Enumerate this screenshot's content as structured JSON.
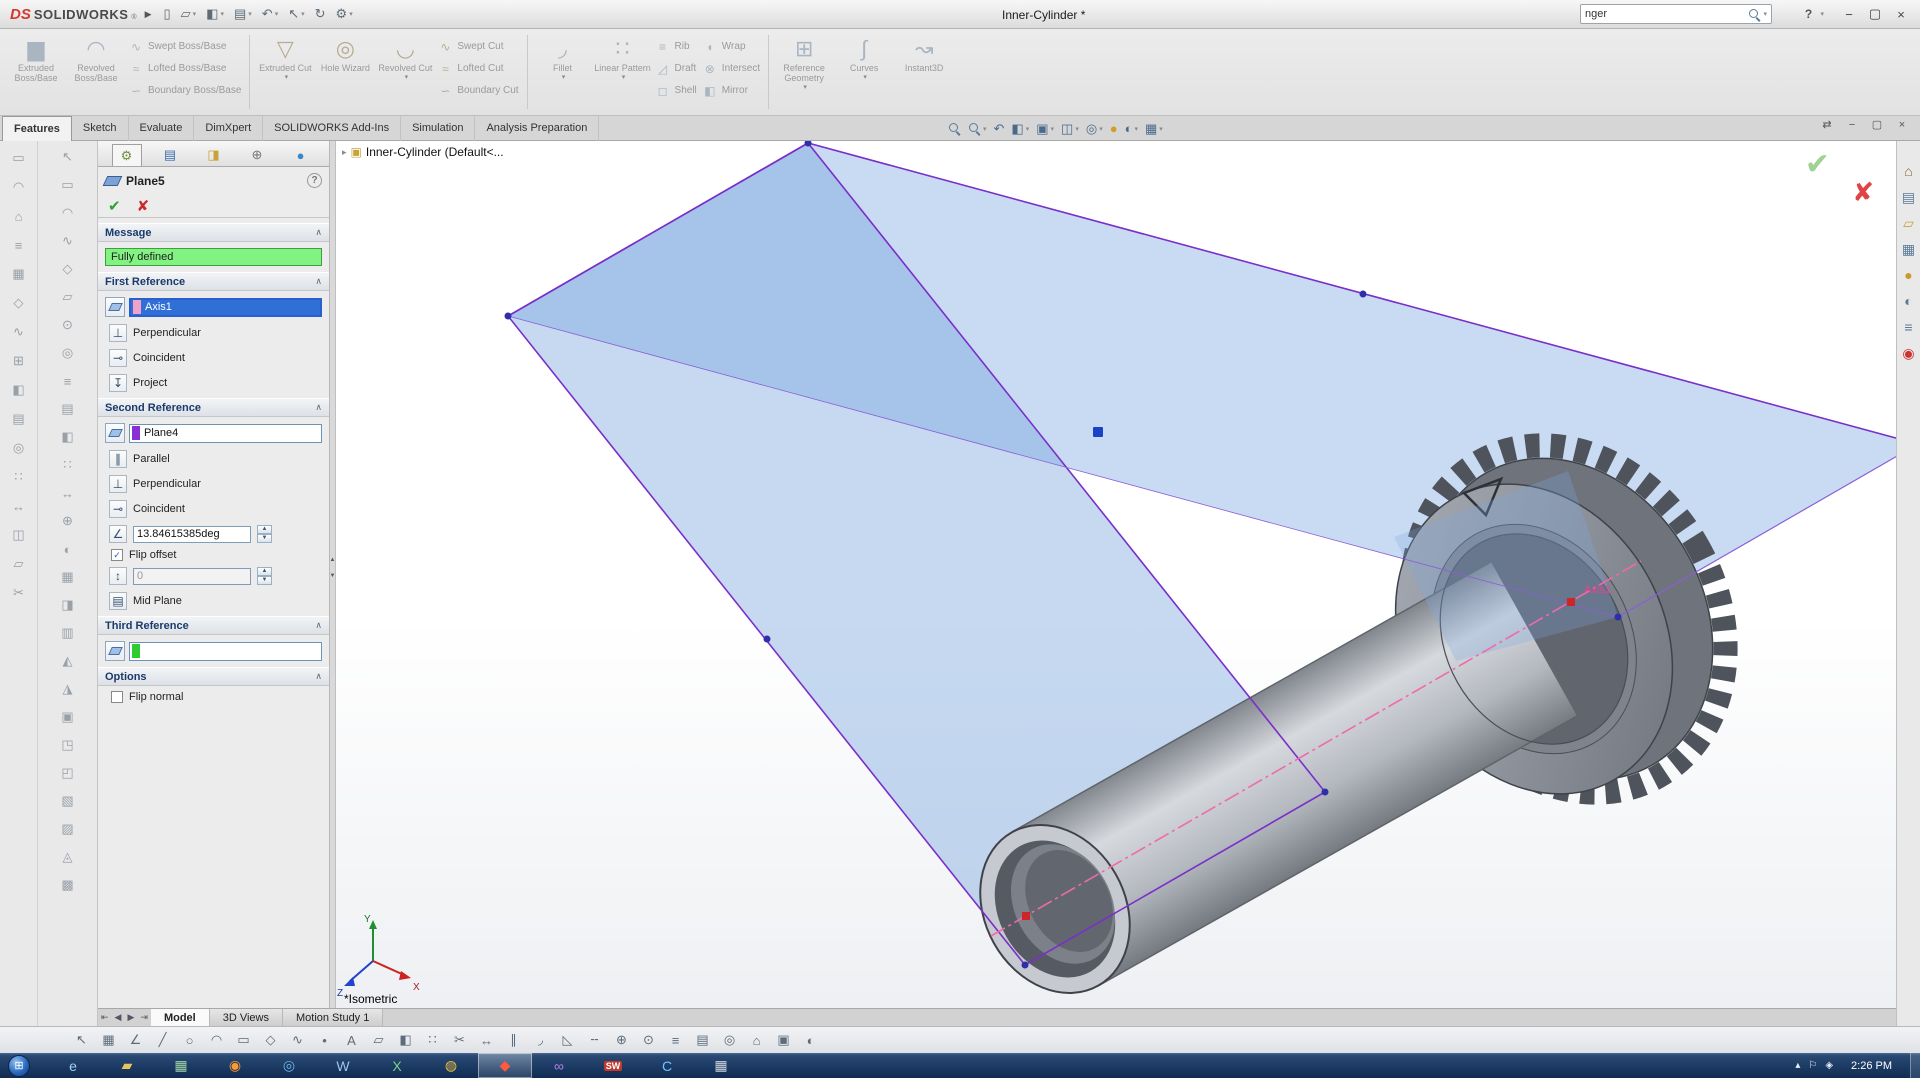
{
  "ui_glyphs": {
    "caret": "▾",
    "chevron_up": "∧",
    "spin_up": "▲",
    "spin_down": "▼",
    "check": "✓",
    "tree_arrow": "▸",
    "orb": "⊞"
  },
  "colors": {
    "accent_blue": "#2f6fd6",
    "plane_fill": "#78a5de",
    "plane_edge": "#7a2fc9",
    "fully_defined_green": "#82f282",
    "axis_pink": "#f06aaa",
    "taskbar_blue": "#1b3a64",
    "selection_pink": "#f2a2c8",
    "reference_purple": "#8a2fd6",
    "reference_green": "#2ecc2e"
  },
  "titlebar": {
    "logo_text": "SOLIDWORKS",
    "logo_mark": "®",
    "logo_ds": "DS",
    "flyout_arrow": "▶",
    "title": "Inner-Cylinder *",
    "search_value": "nger",
    "quick_icons": [
      {
        "name": "new-file-button",
        "glyph": "▯"
      },
      {
        "name": "open-file-button",
        "glyph": "▱",
        "caret": true
      },
      {
        "name": "save-button",
        "glyph": "◧",
        "caret": true
      },
      {
        "name": "print-button",
        "glyph": "▤",
        "caret": true
      },
      {
        "name": "undo-button",
        "glyph": "↶",
        "caret": true
      },
      {
        "name": "select-button",
        "glyph": "↖",
        "caret": true
      },
      {
        "name": "rebuild-button",
        "glyph": "↻"
      },
      {
        "name": "options-button",
        "glyph": "⚙",
        "caret": true
      }
    ]
  },
  "window_controls": {
    "help": "?",
    "pane_toggle": "⇄",
    "minimize": "−",
    "restore": "▢",
    "close": "×"
  },
  "ribbon": {
    "groups": [
      {
        "big": [
          {
            "name": "extruded-boss-base-button",
            "label": "Extruded Boss/Base",
            "glyph": "▆",
            "color": "#a9b6c2"
          },
          {
            "name": "revolved-boss-base-button",
            "label": "Revolved Boss/Base",
            "glyph": "◠",
            "color": "#a9b6c2"
          }
        ],
        "stacks": [
          [
            {
              "name": "swept-boss-base-button",
              "label": "Swept Boss/Base",
              "glyph": "∿",
              "color": "#a9b6c2"
            },
            {
              "name": "lofted-boss-base-button",
              "label": "Lofted Boss/Base",
              "glyph": "≈",
              "color": "#a9b6c2"
            },
            {
              "name": "boundary-boss-base-button",
              "label": "Boundary Boss/Base",
              "glyph": "∽",
              "color": "#a9b6c2"
            }
          ]
        ]
      },
      {
        "big": [
          {
            "name": "extruded-cut-button",
            "label": "Extruded Cut",
            "glyph": "▽",
            "color": "#b7ad93",
            "caret": true
          },
          {
            "name": "hole-wizard-button",
            "label": "Hole Wizard",
            "glyph": "◎",
            "color": "#b7ad93"
          },
          {
            "name": "revolved-cut-button",
            "label": "Revolved Cut",
            "glyph": "◡",
            "color": "#b7ad93",
            "caret": true
          }
        ],
        "stacks": [
          [
            {
              "name": "swept-cut-button",
              "label": "Swept Cut",
              "glyph": "∿",
              "color": "#b7ad93"
            },
            {
              "name": "lofted-cut-button",
              "label": "Lofted Cut",
              "glyph": "≈",
              "color": "#b7ad93"
            },
            {
              "name": "boundary-cut-button",
              "label": "Boundary Cut",
              "glyph": "∽",
              "color": "#b7ad93"
            }
          ]
        ]
      },
      {
        "big": [
          {
            "name": "fillet-button",
            "label": "Fillet",
            "glyph": "◞",
            "color": "#a9b6c2",
            "caret": true
          },
          {
            "name": "linear-pattern-button",
            "label": "Linear Pattern",
            "glyph": "∷",
            "color": "#a9b6c2",
            "caret": true
          }
        ],
        "stacks": [
          [
            {
              "name": "rib-button",
              "label": "Rib",
              "glyph": "≡",
              "color": "#a9b6c2"
            },
            {
              "name": "draft-button",
              "label": "Draft",
              "glyph": "◿",
              "color": "#a9b6c2"
            },
            {
              "name": "shell-button",
              "label": "Shell",
              "glyph": "◻",
              "color": "#a9b6c2"
            }
          ],
          [
            {
              "name": "wrap-button",
              "label": "Wrap",
              "glyph": "◖",
              "color": "#a9b6c2"
            },
            {
              "name": "intersect-button",
              "label": "Intersect",
              "glyph": "⊗",
              "color": "#a9b6c2"
            },
            {
              "name": "mirror-button",
              "label": "Mirror",
              "glyph": "◧",
              "color": "#a9b6c2"
            }
          ]
        ]
      },
      {
        "big": [
          {
            "name": "reference-geometry-button",
            "label": "Reference Geometry",
            "glyph": "⊞",
            "color": "#a9b6c2",
            "caret": true
          },
          {
            "name": "curves-button",
            "label": "Curves",
            "glyph": "∫",
            "color": "#a9b6c2",
            "caret": true
          },
          {
            "name": "instant3d-button",
            "label": "Instant3D",
            "glyph": "↝",
            "color": "#a9b6c2"
          }
        ]
      }
    ]
  },
  "tabs": {
    "active_index": 0,
    "items": [
      "Features",
      "Sketch",
      "Evaluate",
      "DimXpert",
      "SOLIDWORKS Add-Ins",
      "Simulation",
      "Analysis Preparation"
    ]
  },
  "headsup": {
    "items": [
      {
        "name": "zoom-fit-icon",
        "type": "magnifier"
      },
      {
        "name": "zoom-area-icon",
        "type": "magnifier",
        "caret": true
      },
      {
        "name": "previous-view-icon",
        "glyph": "↶"
      },
      {
        "name": "section-view-icon",
        "glyph": "◧",
        "caret": true
      },
      {
        "name": "view-orientation-icon",
        "glyph": "▣",
        "caret": true
      },
      {
        "name": "display-style-icon",
        "glyph": "◫",
        "caret": true
      },
      {
        "name": "hide-show-items-icon",
        "glyph": "◎",
        "caret": true
      },
      {
        "name": "edit-appearance-icon",
        "glyph": "●",
        "color": "#d79b2a"
      },
      {
        "name": "apply-scene-icon",
        "glyph": "◐",
        "caret": true
      },
      {
        "name": "view-settings-icon",
        "glyph": "▦",
        "caret": true
      }
    ]
  },
  "left_toolbar_a": {
    "items": [
      "▭",
      "◠",
      "⌂",
      "≡",
      "▦",
      "◇",
      "∿",
      "⊞",
      "◧",
      "▤",
      "◎",
      "∷",
      "↔",
      "◫",
      "▱",
      "✂"
    ]
  },
  "left_toolbar_b": {
    "items": [
      "↖",
      "▭",
      "◠",
      "∿",
      "◇",
      "▱",
      "⊙",
      "◎",
      "≡",
      "▤",
      "◧",
      "∷",
      "↔",
      "⊕",
      "◐",
      "▦",
      "◨",
      "▥",
      "◭",
      "◮",
      "▣",
      "◳",
      "◰",
      "▧",
      "▨",
      "◬",
      "▩"
    ]
  },
  "pm": {
    "tabs": [
      {
        "name": "propertymanager-tab",
        "glyph": "⚙",
        "color": "#6f8f3f",
        "active": true
      },
      {
        "name": "featuremanager-tab",
        "glyph": "▤",
        "color": "#3d6fae"
      },
      {
        "name": "configurationmanager-tab",
        "glyph": "◨",
        "color": "#c9a23a"
      },
      {
        "name": "dimxpertmanager-tab",
        "glyph": "⊕",
        "color": "#777777"
      },
      {
        "name": "displaymanager-tab",
        "glyph": "●",
        "color": "#3a86c8"
      }
    ],
    "title": "Plane5",
    "help_label": "?",
    "ok_glyph": "✔",
    "cancel_glyph": "✘",
    "sections": {
      "message": {
        "header": "Message",
        "text": "Fully defined"
      },
      "first_reference": {
        "header": "First Reference",
        "value": "Axis1",
        "rows": [
          {
            "label": "Perpendicular",
            "glyph": "⊥"
          },
          {
            "label": "Coincident",
            "glyph": "⊸"
          },
          {
            "label": "Project",
            "glyph": "↧"
          }
        ]
      },
      "second_reference": {
        "header": "Second Reference",
        "value": "Plane4",
        "rows": [
          {
            "label": "Parallel",
            "glyph": "∥"
          },
          {
            "label": "Perpendicular",
            "glyph": "⊥"
          },
          {
            "label": "Coincident",
            "glyph": "⊸"
          }
        ],
        "angle_glyph": "∠",
        "angle_value": "13.84615385deg",
        "flip_offset": {
          "label": "Flip offset",
          "checked": true
        },
        "offset_glyph": "↕",
        "offset_value": "0",
        "mid_plane": {
          "label": "Mid Plane",
          "glyph": "▤"
        }
      },
      "third_reference": {
        "header": "Third Reference",
        "value": ""
      },
      "options": {
        "header": "Options",
        "flip_normal": {
          "label": "Flip normal",
          "checked": false
        }
      }
    }
  },
  "viewport": {
    "tree_arrow": "▸",
    "tree_label": "Inner-Cylinder  (Default<...",
    "view_label": "*Isometric",
    "axis_label": "Axis1",
    "triad": {
      "x": "X",
      "y": "Y",
      "z": "Z"
    }
  },
  "task_pane": {
    "items": [
      {
        "name": "task-pane-home-icon",
        "glyph": "⌂",
        "color": "#8a6a3a"
      },
      {
        "name": "design-library-icon",
        "glyph": "▤",
        "color": "#5a7a9a"
      },
      {
        "name": "file-explorer-icon",
        "glyph": "▱",
        "color": "#c9a23a"
      },
      {
        "name": "view-palette-icon",
        "glyph": "▦",
        "color": "#5a7a9a"
      },
      {
        "name": "appearances-icon",
        "glyph": "●",
        "color": "#c99b2d"
      },
      {
        "name": "scene-icon",
        "glyph": "◐",
        "color": "#5a7a9a"
      },
      {
        "name": "custom-properties-icon",
        "glyph": "≡",
        "color": "#5a7a9a"
      },
      {
        "name": "forum-icon",
        "glyph": "◉",
        "color": "#cc3333"
      }
    ]
  },
  "bottom_tabs": {
    "active_index": 0,
    "nav": [
      "⇤",
      "◀",
      "▶",
      "⇥"
    ],
    "items": [
      "Model",
      "3D Views",
      "Motion Study 1"
    ]
  },
  "bottom_toolbar": {
    "items": [
      "↖",
      "▦",
      "∠",
      "╱",
      "○",
      "◠",
      "▭",
      "◇",
      "∿",
      "•",
      "A",
      "▱",
      "◧",
      "∷",
      "✂",
      "↔",
      "∥",
      "◞",
      "◺",
      "╌",
      "⊕",
      "⊙",
      "≡",
      "▤",
      "◎",
      "⌂",
      "▣",
      "◐"
    ]
  },
  "taskbar": {
    "start_glyph": "⊞",
    "items": [
      {
        "name": "taskbar-internet-explorer",
        "glyph": "e",
        "color": "#9fd0ff"
      },
      {
        "name": "taskbar-explorer-folder",
        "glyph": "▰",
        "color": "#e8c35a"
      },
      {
        "name": "taskbar-office-grid",
        "glyph": "▦",
        "color": "#9fd4a8"
      },
      {
        "name": "taskbar-firefox",
        "glyph": "◉",
        "color": "#ff9a2e"
      },
      {
        "name": "taskbar-safari",
        "glyph": "◎",
        "color": "#6db3e8"
      },
      {
        "name": "taskbar-word",
        "glyph": "W",
        "color": "#9ec4f0"
      },
      {
        "name": "taskbar-excel",
        "glyph": "X",
        "color": "#7fd08a"
      },
      {
        "name": "taskbar-chrome",
        "glyph": "◍",
        "color": "#f0c040"
      },
      {
        "name": "taskbar-solidworks",
        "glyph": "◆",
        "color": "#ff5a3c",
        "active": true
      },
      {
        "name": "taskbar-visual-studio",
        "glyph": "∞",
        "color": "#b07fe8"
      },
      {
        "name": "taskbar-solidworks-launcher",
        "glyph": "SW",
        "color": "#ffffff",
        "bg": "#c0392b"
      },
      {
        "name": "taskbar-corel",
        "glyph": "C",
        "color": "#6fc3ff"
      },
      {
        "name": "taskbar-calculator",
        "glyph": "▦",
        "color": "#cfd6de"
      }
    ],
    "tray": {
      "items": [
        "▴",
        "⚐",
        "◈"
      ],
      "clock": "2:26 PM"
    }
  }
}
